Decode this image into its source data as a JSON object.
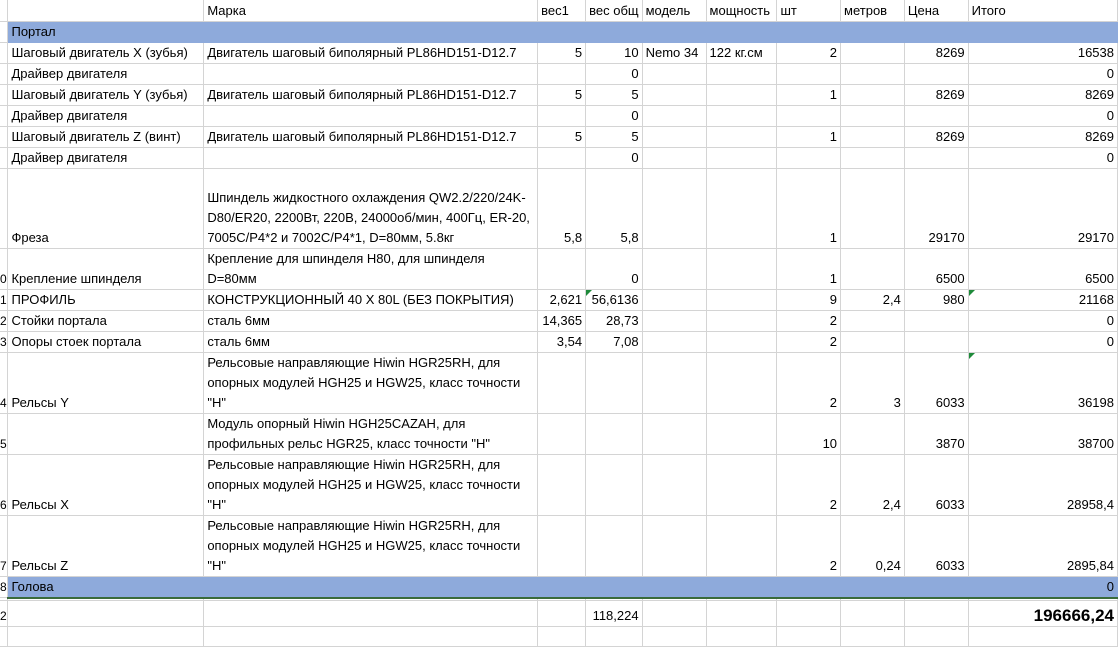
{
  "headers": {
    "marka": "Марка",
    "ves1": "вес1",
    "ves_obsh": "вес общ",
    "model": "модель",
    "moshnost": "мощность",
    "sht": "шт",
    "metrov": "метров",
    "cena": "Цена",
    "itogo": "Итого"
  },
  "section_portal": "Портал",
  "section_golova": "Голова",
  "section_golova_total": "0",
  "row_numbers": {
    "r10": "0",
    "r11": "1",
    "r12": "2",
    "r13": "3",
    "r14": "4",
    "r15": "5",
    "r16": "6",
    "r17": "7",
    "r18": "8",
    "r_total": "2"
  },
  "rows": [
    {
      "name": "Шаговый двигатель X (зубья)",
      "marka": "Двигатель шаговый биполярный PL86HD151-D12.7",
      "ves1": "5",
      "ves_obsh": "10",
      "model": "Nemo 34",
      "moshnost": "122 кг.см",
      "sht": "2",
      "metrov": "",
      "cena": "8269",
      "itogo": "16538"
    },
    {
      "name": "Драйвер двигателя",
      "marka": "",
      "ves1": "",
      "ves_obsh": "0",
      "model": "",
      "moshnost": "",
      "sht": "",
      "metrov": "",
      "cena": "",
      "itogo": "0"
    },
    {
      "name": "Шаговый двигатель Y (зубья)",
      "marka": "Двигатель шаговый биполярный PL86HD151-D12.7",
      "ves1": "5",
      "ves_obsh": "5",
      "model": "",
      "moshnost": "",
      "sht": "1",
      "metrov": "",
      "cena": "8269",
      "itogo": "8269"
    },
    {
      "name": "Драйвер двигателя",
      "marka": "",
      "ves1": "",
      "ves_obsh": "0",
      "model": "",
      "moshnost": "",
      "sht": "",
      "metrov": "",
      "cena": "",
      "itogo": "0"
    },
    {
      "name": "Шаговый двигатель Z (винт)",
      "marka": "Двигатель шаговый биполярный PL86HD151-D12.7",
      "ves1": "5",
      "ves_obsh": "5",
      "model": "",
      "moshnost": "",
      "sht": "1",
      "metrov": "",
      "cena": "8269",
      "itogo": "8269"
    },
    {
      "name": "Драйвер двигателя",
      "marka": "",
      "ves1": "",
      "ves_obsh": "0",
      "model": "",
      "moshnost": "",
      "sht": "",
      "metrov": "",
      "cena": "",
      "itogo": "0"
    },
    {
      "name": "Фреза",
      "marka": "Шпиндель жидкостного охлаждения QW2.2/220/24K-D80/ER20, 2200Вт, 220В, 24000об/мин, 400Гц, ER-20, 7005C/P4*2 и 7002C/P4*1, D=80мм, 5.8кг",
      "ves1": "5,8",
      "ves_obsh": "5,8",
      "model": "",
      "moshnost": "",
      "sht": "1",
      "metrov": "",
      "cena": "29170",
      "itogo": "29170"
    },
    {
      "name": "Крепление шпинделя",
      "marka": "Крепление для шпинделя H80, для шпинделя D=80мм",
      "ves1": "",
      "ves_obsh": "0",
      "model": "",
      "moshnost": "",
      "sht": "1",
      "metrov": "",
      "cena": "6500",
      "itogo": "6500"
    },
    {
      "name": "ПРОФИЛЬ",
      "marka": "КОНСТРУКЦИОННЫЙ 40 Х 80L (БЕЗ ПОКРЫТИЯ)",
      "ves1": "2,621",
      "ves_obsh": "56,6136",
      "model": "",
      "moshnost": "",
      "sht": "9",
      "metrov": "2,4",
      "cena": "980",
      "itogo": "21168"
    },
    {
      "name": "Стойки портала",
      "marka": "сталь 6мм",
      "ves1": "14,365",
      "ves_obsh": "28,73",
      "model": "",
      "moshnost": "",
      "sht": "2",
      "metrov": "",
      "cena": "",
      "itogo": "0"
    },
    {
      "name": "Опоры стоек портала",
      "marka": "сталь 6мм",
      "ves1": "3,54",
      "ves_obsh": "7,08",
      "model": "",
      "moshnost": "",
      "sht": "2",
      "metrov": "",
      "cena": "",
      "itogo": "0"
    },
    {
      "name": "Рельсы Y",
      "marka": "Рельсовые направляющие Hiwin HGR25RH, для опорных модулей HGH25 и HGW25, класс точности \"Н\"",
      "ves1": "",
      "ves_obsh": "",
      "model": "",
      "moshnost": "",
      "sht": "2",
      "metrov": "3",
      "cena": "6033",
      "itogo": "36198"
    },
    {
      "name": "",
      "marka": "Модуль опорный Hiwin HGH25CAZAH, для профильных рельс HGR25, класс точности \"Н\"",
      "ves1": "",
      "ves_obsh": "",
      "model": "",
      "moshnost": "",
      "sht": "10",
      "metrov": "",
      "cena": "3870",
      "itogo": "38700"
    },
    {
      "name": "Рельсы X",
      "marka": "Рельсовые направляющие Hiwin HGR25RH, для опорных модулей HGH25 и HGW25, класс точности \"Н\"",
      "ves1": "",
      "ves_obsh": "",
      "model": "",
      "moshnost": "",
      "sht": "2",
      "metrov": "2,4",
      "cena": "6033",
      "itogo": "28958,4"
    },
    {
      "name": "Рельсы Z",
      "marka": "Рельсовые направляющие Hiwin HGR25RH, для опорных модулей HGH25 и HGW25, класс точности \"Н\"",
      "ves1": "",
      "ves_obsh": "",
      "model": "",
      "moshnost": "",
      "sht": "2",
      "metrov": "0,24",
      "cena": "6033",
      "itogo": "2895,84"
    }
  ],
  "totals": {
    "ves_obsh": "118,224",
    "itogo": "196666,24"
  },
  "colors": {
    "section_fill": "#8eaadb",
    "gridline": "#d4d4d4",
    "comment_marker": "#1e8a3a"
  }
}
